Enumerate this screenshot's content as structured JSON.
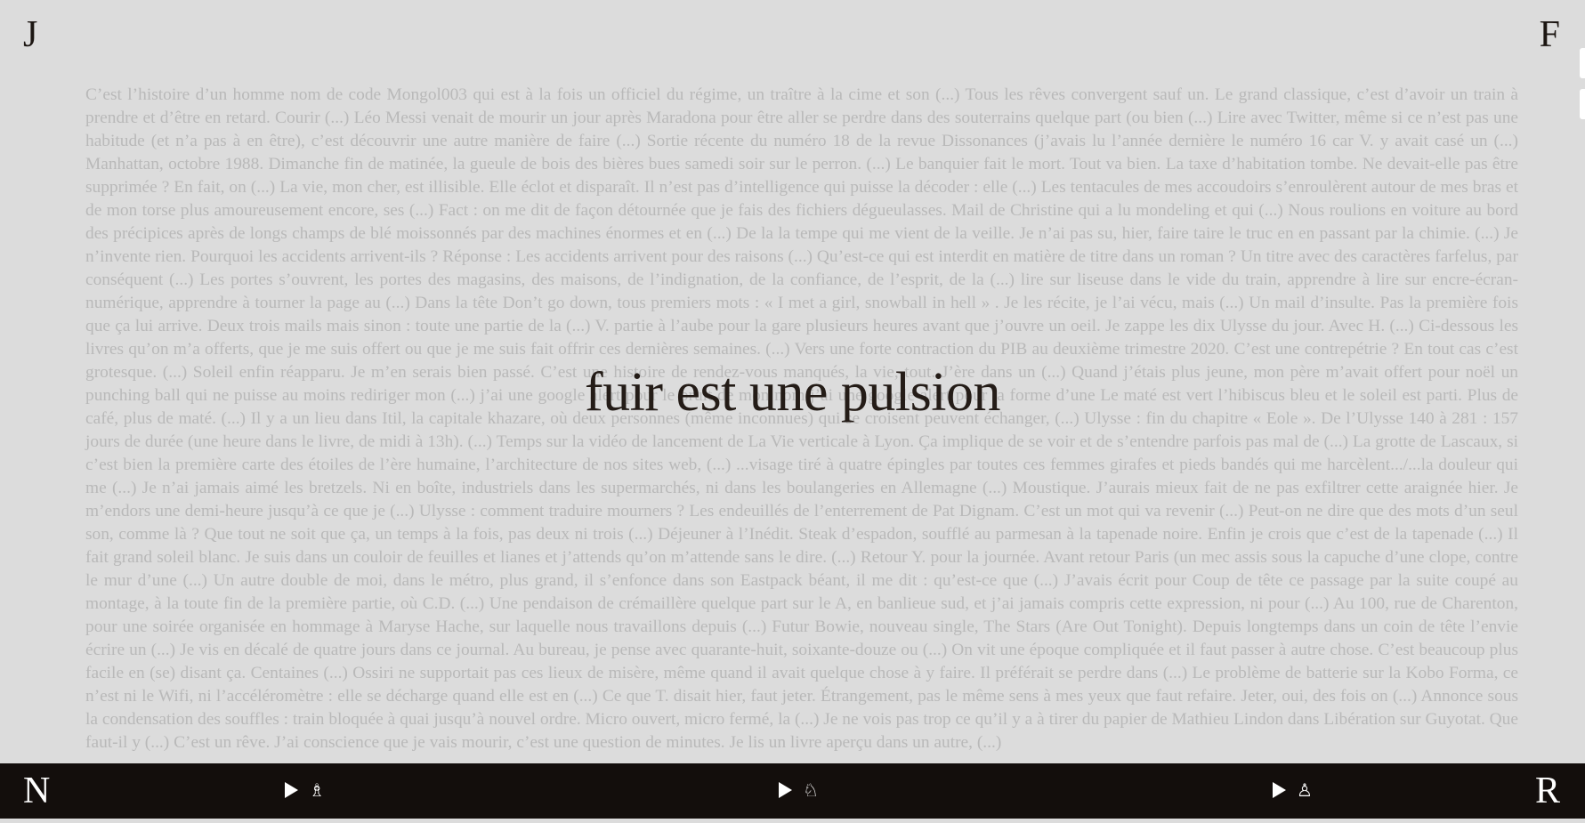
{
  "corners": {
    "top_left": "J",
    "top_right": "F"
  },
  "headline": "fuir est une pulsion",
  "body_text": "C’est l’histoire d’un homme nom de code Mongol003 qui est à la fois un officiel du régime, un traître à la cime et son (...) Tous les rêves convergent sauf un. Le grand classique, c’est d’avoir un train à prendre et d’être en retard. Courir (...) Léo Messi venait de mourir un jour après Maradona pour être aller se perdre dans des souterrains quelque part (ou bien (...) Lire avec Twitter, même si ce n’est pas une habitude (et n’a pas à en être), c’est découvrir une autre manière de faire (...) Sortie récente du numéro 18 de la revue Dissonances (j’avais lu l’année dernière le numéro 16 car V. y avait casé un (...) Manhattan, octobre 1988. Dimanche fin de matinée, la gueule de bois des bières bues samedi soir sur le perron. (...) Le banquier fait le mort. Tout va bien. La taxe d’habitation tombe. Ne devait-elle pas être supprimée ? En fait, on (...) La vie, mon cher, est illisible. Elle éclot et disparaît. Il n’est pas d’intelligence qui puisse la décoder : elle (...) Les tentacules de mes accoudoirs s’enroulèrent autour de mes bras et de mon torse plus amoureusement encore, ses (...) Fact : on me dit de façon détournée que je fais des fichiers dégueulasses. Mail de Christine qui a lu mondeling et qui (...) Nous roulions en voiture au bord des précipices après de longs champs de blé moissonnés par des machines énormes et en (...) De la la tempe qui me vient de la veille. Je n’ai pas su, hier, faire taire le truc en en passant par la chimie. (...) Je n’invente rien. Pourquoi les accidents arrivent-ils ? Réponse : Les accidents arrivent pour des raisons (...) Qu’est-ce qui est interdit en matière de titre dans un roman ? Un titre avec des caractères farfelus, par conséquent (...) Les portes s’ouvrent, les portes des magasins, des maisons, de l’indignation, de la confiance, de l’esprit, de la (...) lire sur liseuse dans le vide du train, apprendre à lire sur encre-écran-numérique, apprendre à tourner la page au (...) Dans la tête Don’t go down, tous premiers mots : « I met a girl, snowball in hell » . Je les récite, je l’ai vécu, mais (...) Un mail d’insulte. Pas la première fois que ça lui arrive. Deux trois mails mais sinon : toute une partie de la (...) V. partie à l’aube pour la gare plusieurs heures avant que j’ouvre un oeil. Je zappe les dix Ulysse du jour. Avec H. (...) Ci-dessous les livres qu’on m’a offerts, que je me suis offert ou que je me suis fait offrir ces dernières semaines. (...) Vers une forte contraction du PIB au deuxième trimestre 2020. C’est une contrepétrie ? En tout cas c’est grotesque. (...) Soleil enfin réapparu. Je m’en serais bien passé. C’est une histoire de rendez-vous manqués, la vie, tout. J’ère dans un (...) Quand j’étais plus jeune, mon père m’avait offert pour noël un punching ball qui ne puisse au moins rediriger mon (...) j’ai une google alert pour le bruit de mon nom j’ai une google alert pour la forme d’une Le maté est vert l’hibiscus bleu et le soleil est parti. Plus de café, plus de maté. (...) Il y a un lieu dans Itil, la capitale khazare, où deux personnes (même inconnues) qui se croisent peuvent échanger, (...) Ulysse : fin du chapitre « Eole ». De l’Ulysse 140 à 281 : 157 jours de durée (une heure dans le livre, de midi à 13h). (...) Temps sur la vidéo de lancement de La Vie verticale à Lyon. Ça implique de se voir et de s’entendre parfois pas mal de (...) La grotte de Lascaux, si c’est bien la première carte des étoiles de l’ère humaine, l’architecture de nos sites web, (...) ...visage tiré à quatre épingles par toutes ces femmes girafes et pieds bandés qui me harcèlent.../...la douleur qui me (...) Je n’ai jamais aimé les bretzels. Ni en boîte, industriels dans les supermarchés, ni dans les boulangeries en Allemagne (...) Moustique. J’aurais mieux fait de ne pas exfiltrer cette araignée hier. Je m’endors une demi-heure jusqu’à ce que je (...) Ulysse : comment traduire mourners ? Les endeuillés de l’enterrement de Pat Dignam. C’est un mot qui va revenir (...) Peut-on ne dire que des mots d’un seul son, comme là ? Que tout ne soit que ça, un temps à la fois, pas deux ni trois (...) Déjeuner à l’Inédit. Steak d’espadon, soufflé au parmesan à la tapenade noire. Enfin je crois que c’est de la tapenade (...) Il fait grand soleil blanc. Je suis dans un couloir de feuilles et lianes et j’attends qu’on m’attende sans le dire. (...) Retour Y. pour la journée. Avant retour Paris (un mec assis sous la capuche d’une clope, contre le mur d’une (...) Un autre double de moi, dans le métro, plus grand, il s’enfonce dans son Eastpack béant, il me dit : qu’est-ce que (...) J’avais écrit pour Coup de tête ce passage par la suite coupé au montage, à la toute fin de la première partie, où C.D. (...) Une pendaison de crémaillère quelque part sur le A, en banlieue sud, et j’ai jamais compris cette expression, ni pour (...) Au 100, rue de Charenton, pour une soirée organisée en hommage à Maryse Hache, sur laquelle nous travaillons depuis (...) Futur Bowie, nouveau single, The Stars (Are Out Tonight). Depuis longtemps dans un coin de tête l’envie écrire un (...) Je vis en décalé de quatre jours dans ce journal. Au bureau, je pense avec quarante-huit, soixante-douze ou (...) On vit une époque compliquée et il faut passer à autre chose. C’est beaucoup plus facile en (se) disant ça. Centaines (...) Ossiri ne supportait pas ces lieux de misère, même quand il avait quelque chose à y faire. Il préférait se perdre dans (...) Le problème de batterie sur la Kobo Forma, ce n’est ni le Wifi, ni l’accéléromètre : elle se décharge quand elle est en (...) Ce que T. disait hier, faut jeter. Étrangement, pas le même sens à mes yeux que faut refaire. Jeter, oui, des fois on (...) Annonce sous la condensation des souffles : train bloquée à quai jusqu’à nouvel ordre. Micro ouvert, micro fermé, la (...) Je ne vois pas trop ce qu’il y a à tirer du papier de Mathieu Lindon dans Libération sur Guyotat. Que faut-il y (...) C’est un rêve. J’ai conscience que je vais mourir, c’est une question de minutes. Je lis un livre aperçu dans un autre, (...)",
  "footer": {
    "left": "N",
    "right": "R",
    "players": [
      {
        "icon": "♗"
      },
      {
        "icon": "♘"
      },
      {
        "icon": "♙"
      }
    ]
  },
  "colors": {
    "background": "#dcdcdc",
    "footer": "#130e0c",
    "headline": "#241c17",
    "body_text": "#b9b9b9"
  }
}
